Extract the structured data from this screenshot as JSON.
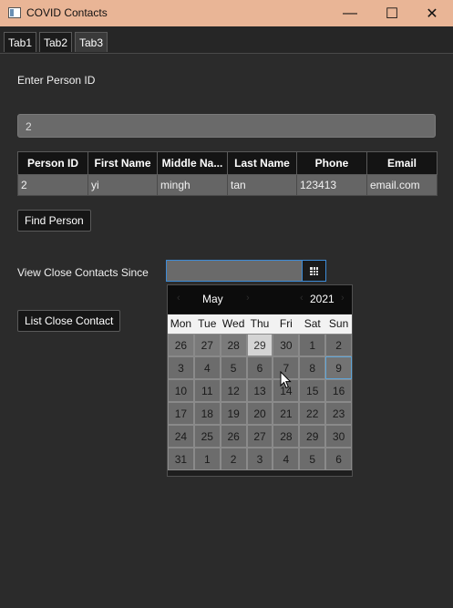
{
  "window": {
    "title": "COVID Contacts",
    "minimize": "—",
    "maximize": "☐",
    "close": "✕"
  },
  "tabs": [
    {
      "label": "Tab1"
    },
    {
      "label": "Tab2"
    },
    {
      "label": "Tab3"
    }
  ],
  "form": {
    "person_id_label": "Enter Person ID",
    "person_id_value": "2",
    "find_button": "Find Person",
    "since_label": "View Close Contacts Since",
    "list_button": "List Close Contact"
  },
  "table": {
    "columns": [
      "Person ID",
      "First Name",
      "Middle Na...",
      "Last Name",
      "Phone",
      "Email"
    ],
    "rows": [
      [
        "2",
        "yi",
        "mingh",
        "tan",
        "123413",
        "email.com"
      ]
    ]
  },
  "calendar": {
    "month": "May",
    "year": "2021",
    "prev": "‹",
    "next": "›",
    "weekdays": [
      "Mon",
      "Tue",
      "Wed",
      "Thu",
      "Fri",
      "Sat",
      "Sun"
    ],
    "weeks": [
      [
        "26",
        "27",
        "28",
        "29",
        "30",
        "1",
        "2"
      ],
      [
        "3",
        "4",
        "5",
        "6",
        "7",
        "8",
        "9"
      ],
      [
        "10",
        "11",
        "12",
        "13",
        "14",
        "15",
        "16"
      ],
      [
        "17",
        "18",
        "19",
        "20",
        "21",
        "22",
        "23"
      ],
      [
        "24",
        "25",
        "26",
        "27",
        "28",
        "29",
        "30"
      ],
      [
        "31",
        "1",
        "2",
        "3",
        "4",
        "5",
        "6"
      ]
    ]
  },
  "icons": {
    "app": "window-icon",
    "calendar": "calendar-icon",
    "cursor": "mouse-pointer-icon"
  }
}
